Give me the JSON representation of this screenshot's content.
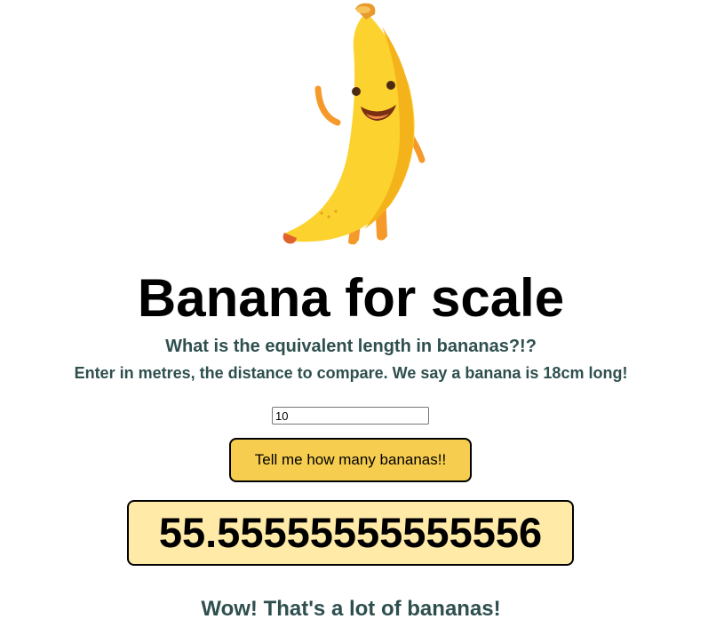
{
  "header": {
    "title": "Banana for scale",
    "subtitle": "What is the equivalent length in bananas?!?",
    "instructions": "Enter in metres, the distance to compare. We say a banana is 18cm long!"
  },
  "form": {
    "distance_value": "10",
    "submit_label": "Tell me how many bananas!!"
  },
  "result": {
    "value": "55.55555555555556",
    "comment": "Wow! That's a lot of bananas!"
  },
  "colors": {
    "button": "#f6cd4f",
    "result_background": "#ffeaa7",
    "heading_text": "#2f4f4f"
  },
  "icons": {
    "mascot": "banana-mascot-icon"
  }
}
